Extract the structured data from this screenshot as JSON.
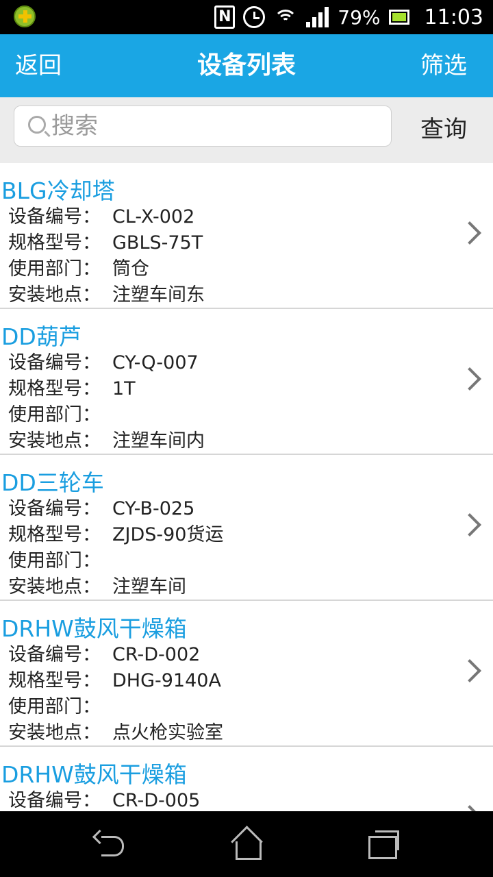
{
  "status_bar": {
    "battery_percent": "79%",
    "time": "11:03",
    "icons": [
      "app-notification-icon",
      "nfc-icon",
      "alarm-icon",
      "wifi-icon",
      "signal-icon",
      "battery-icon"
    ]
  },
  "header": {
    "back_label": "返回",
    "title": "设备列表",
    "filter_label": "筛选",
    "color": "#1aa6e4"
  },
  "search": {
    "placeholder": "搜索",
    "value": "",
    "query_label": "查询"
  },
  "field_labels": {
    "code": "设备编号：",
    "model": "规格型号：",
    "department": "使用部门：",
    "location": "安装地点："
  },
  "devices": [
    {
      "name": "BLG冷却塔",
      "code": "CL-X-002",
      "model": "GBLS-75T",
      "department": "筒仓",
      "location": "注塑车间东"
    },
    {
      "name": "DD葫芦",
      "code": "CY-Q-007",
      "model": "1T",
      "department": "",
      "location": "注塑车间内"
    },
    {
      "name": "DD三轮车",
      "code": "CY-B-025",
      "model": "ZJDS-90货运",
      "department": "",
      "location": "注塑车间"
    },
    {
      "name": "DRHW鼓风干燥箱",
      "code": "CR-D-002",
      "model": "DHG-9140A",
      "department": "",
      "location": "点火枪实验室"
    },
    {
      "name": "DRHW鼓风干燥箱",
      "code": "CR-D-005",
      "model": "",
      "department": "",
      "location": ""
    }
  ],
  "nav_bar": {
    "icons": [
      "back-nav-icon",
      "home-nav-icon",
      "recent-apps-icon"
    ]
  }
}
